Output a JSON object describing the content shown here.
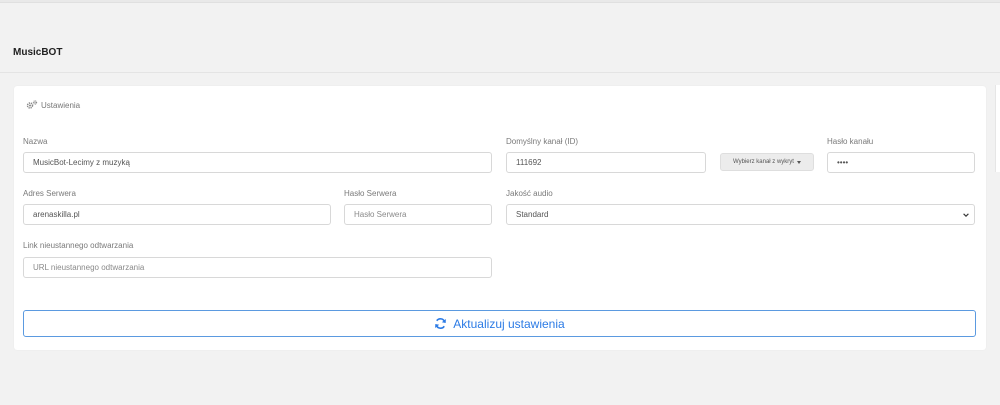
{
  "header": {
    "title": "MusicBOT"
  },
  "settings": {
    "card_title": "Ustawienia",
    "name": {
      "label": "Nazwa",
      "value": "MusicBot-Lecimy z muzyką"
    },
    "default_channel": {
      "label": "Domyślny kanał (ID)",
      "value": "111692"
    },
    "channel_picker": {
      "label": "Wybierz kanał z wykryt"
    },
    "channel_password": {
      "label": "Hasło kanału",
      "value": "••••"
    },
    "server_address": {
      "label": "Adres Serwera",
      "value": "arenaskilla.pl"
    },
    "server_password": {
      "label": "Hasło Serwera",
      "placeholder": "Hasło Serwera"
    },
    "audio_quality": {
      "label": "Jakość audio",
      "value": "Standard"
    },
    "stream_link": {
      "label": "Link nieustannego odtwarzania",
      "placeholder": "URL nieustannego odtwarzania"
    },
    "update_button": {
      "label": "Aktualizuj ustawienia"
    }
  },
  "colors": {
    "accent": "#2c7be5",
    "background": "#f2f2f2",
    "card": "#ffffff"
  },
  "icons": {
    "settings": "cogs-icon",
    "update": "sync-icon",
    "select": "chevron-down-icon"
  }
}
